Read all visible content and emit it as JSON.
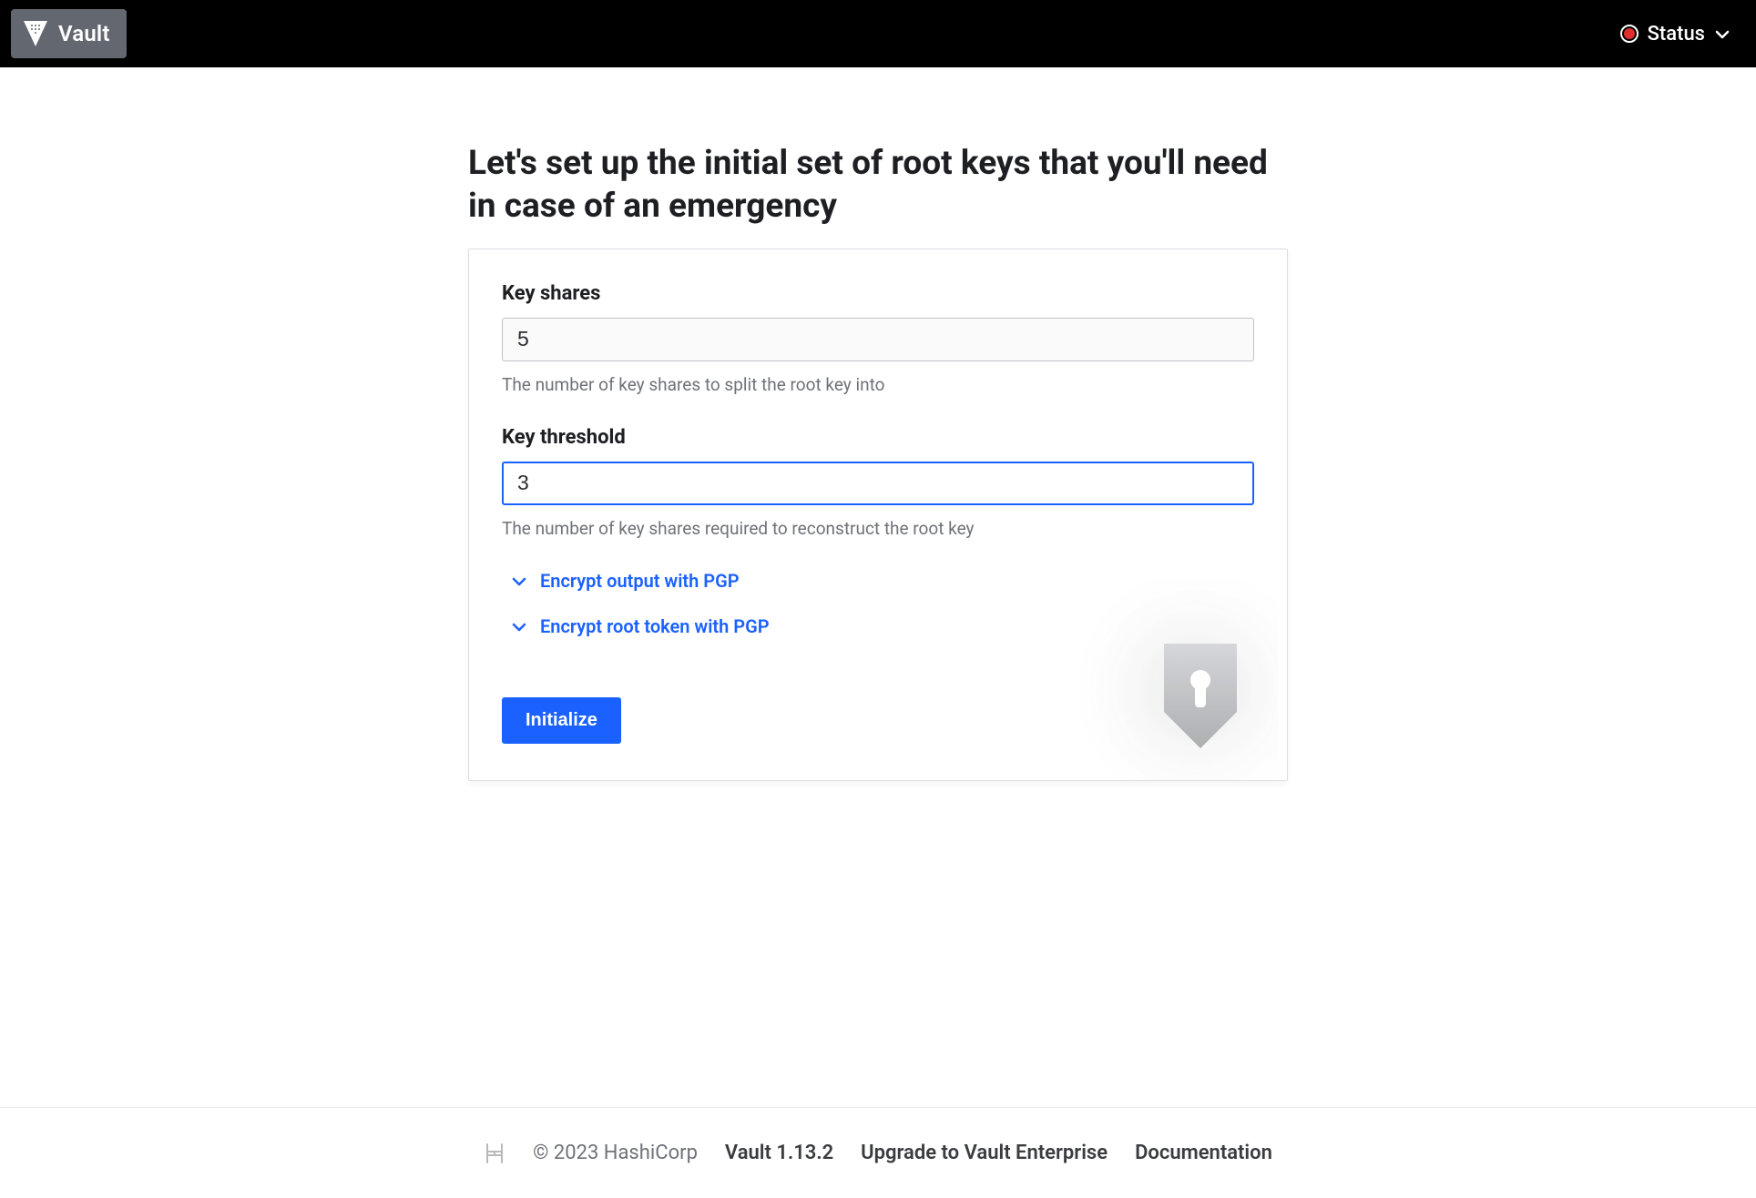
{
  "header": {
    "brand": "Vault",
    "status_label": "Status",
    "status_color": "#e02d2d"
  },
  "page": {
    "title": "Let's set up the initial set of root keys that you'll need in case of an emergency"
  },
  "form": {
    "key_shares": {
      "label": "Key shares",
      "value": "5",
      "help": "The number of key shares to split the root key into"
    },
    "key_threshold": {
      "label": "Key threshold",
      "value": "3",
      "help": "The number of key shares required to reconstruct the root key"
    },
    "expanders": {
      "encrypt_output": "Encrypt output with PGP",
      "encrypt_root_token": "Encrypt root token with PGP"
    },
    "submit_label": "Initialize"
  },
  "footer": {
    "copyright": "© 2023 HashiCorp",
    "version": "Vault 1.13.2",
    "upgrade": "Upgrade to Vault Enterprise",
    "documentation": "Documentation"
  }
}
